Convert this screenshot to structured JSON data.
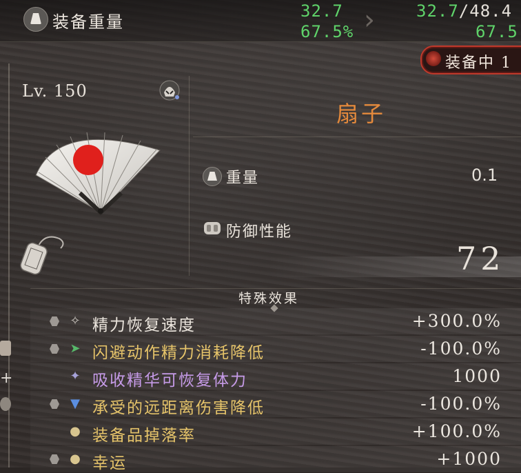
{
  "top": {
    "label": "装备重量",
    "current_weight": "32.7",
    "current_percent": "67.5%",
    "new_weight": "32.7",
    "max_weight": "/48.4",
    "new_percent": "67.5"
  },
  "equipped_tag": "装备中 1",
  "item": {
    "level": "Lv. 150",
    "name": "扇子",
    "weight_label": "重量",
    "weight_value": "0.1",
    "defense_label": "防御性能",
    "defense_value": "72"
  },
  "effects": {
    "title": "特殊效果",
    "rows": [
      {
        "label": "精力恢复速度",
        "value": "+300.0%",
        "color": "#ebe5dd",
        "icon": "sparkle-icon"
      },
      {
        "label": "闪避动作精力消耗降低",
        "value": "-100.0%",
        "color": "#e6c46a",
        "icon": "dash-icon"
      },
      {
        "label": "吸收精华可恢复体力",
        "value": "1000",
        "color": "#c69be8",
        "icon": "sparkle-purple-icon"
      },
      {
        "label": "承受的远距离伤害降低",
        "value": "-100.0%",
        "color": "#e6c46a",
        "icon": "triangle-down-icon"
      },
      {
        "label": "装备品掉落率",
        "value": "+100.0%",
        "color": "#e6c46a",
        "icon": "pouch-icon"
      },
      {
        "label": "幸运",
        "value": "+1000",
        "color": "#e6c46a",
        "icon": "pouch-icon"
      }
    ]
  },
  "colors": {
    "positive": "#5fd36a",
    "item_name": "#e58a3c",
    "equipped_border": "#c0392b"
  }
}
